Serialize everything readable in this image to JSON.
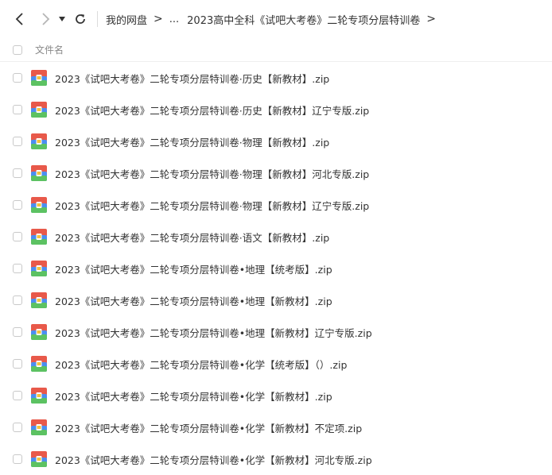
{
  "toolbar": {
    "back_icon": "chevron-left-icon",
    "forward_icon": "chevron-right-icon",
    "history_icon": "caret-down-icon",
    "refresh_icon": "refresh-icon"
  },
  "breadcrumb": {
    "items": [
      "我的网盘",
      "...",
      "2023高中全科《试吧大考卷》二轮专项分层特训卷"
    ],
    "separator": ">"
  },
  "table": {
    "column_header": "文件名"
  },
  "files": [
    "2023《试吧大考卷》二轮专项分层特训卷·历史【新教材】.zip",
    "2023《试吧大考卷》二轮专项分层特训卷·历史【新教材】辽宁专版.zip",
    "2023《试吧大考卷》二轮专项分层特训卷·物理【新教材】.zip",
    "2023《试吧大考卷》二轮专项分层特训卷·物理【新教材】河北专版.zip",
    "2023《试吧大考卷》二轮专项分层特训卷·物理【新教材】辽宁专版.zip",
    "2023《试吧大考卷》二轮专项分层特训卷·语文【新教材】.zip",
    "2023《试吧大考卷》二轮专项分层特训卷•地理【统考版】.zip",
    "2023《试吧大考卷》二轮专项分层特训卷•地理【新教材】.zip",
    "2023《试吧大考卷》二轮专项分层特训卷•地理【新教材】辽宁专版.zip",
    "2023《试吧大考卷》二轮专项分层特训卷•化学【统考版】（）.zip",
    "2023《试吧大考卷》二轮专项分层特训卷•化学【新教材】.zip",
    "2023《试吧大考卷》二轮专项分层特训卷•化学【新教材】不定项.zip",
    "2023《试吧大考卷》二轮专项分层特训卷•化学【新教材】河北专版.zip"
  ],
  "file_icon": "zip-archive-icon",
  "colors": {
    "text": "#333333",
    "muted": "#888888",
    "border": "#eeeeee",
    "zip_red": "#e8594a",
    "zip_blue": "#4b8ef0",
    "zip_green": "#5cc262",
    "zip_yellow": "#f5c33b"
  }
}
